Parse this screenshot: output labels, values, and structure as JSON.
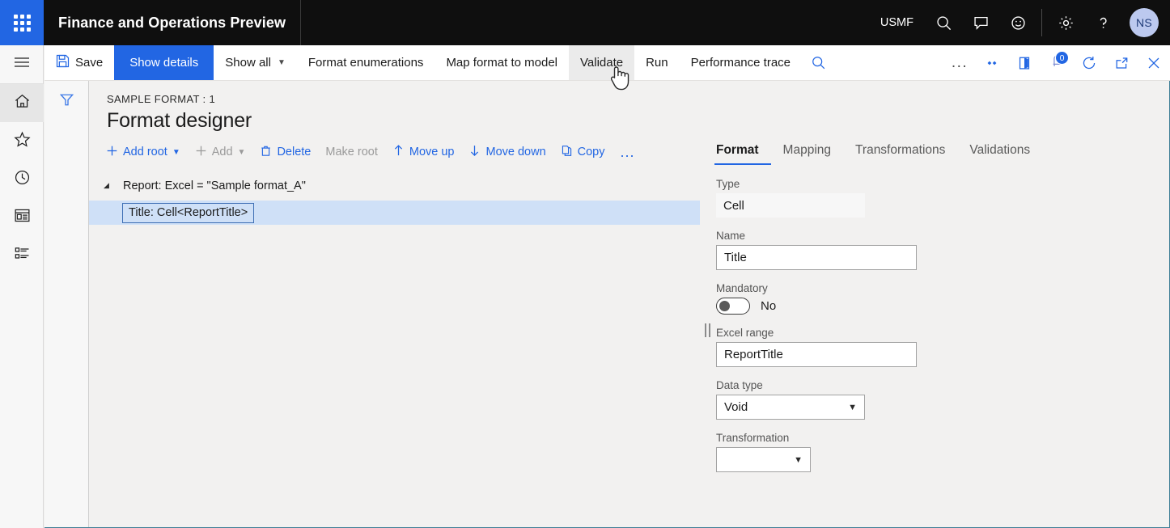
{
  "topbar": {
    "waffle_name": "app-launcher",
    "brand": "Finance and Operations Preview",
    "company": "USMF",
    "icons": [
      "search-icon",
      "feedback-icon",
      "smiley-icon",
      "settings-icon",
      "help-icon"
    ],
    "avatar_initials": "NS",
    "background": "#0f0f0f",
    "accent": "#2266e3"
  },
  "rail": {
    "items": [
      {
        "name": "hamburger-menu",
        "label": "Expand navigation"
      },
      {
        "name": "home",
        "label": "Home",
        "active": true
      },
      {
        "name": "favorites",
        "label": "Favorites"
      },
      {
        "name": "recent",
        "label": "Recent"
      },
      {
        "name": "workspaces",
        "label": "Workspaces"
      },
      {
        "name": "modules",
        "label": "Modules"
      }
    ]
  },
  "commandbar": {
    "save_label": "Save",
    "show_details_label": "Show details",
    "show_all_label": "Show all",
    "format_enumerations_label": "Format enumerations",
    "map_format_to_model_label": "Map format to model",
    "validate_label": "Validate",
    "run_label": "Run",
    "performance_trace_label": "Performance trace",
    "overflow_label": "...",
    "notification_count": "0",
    "primary_color": "#2266e3"
  },
  "page": {
    "eyebrow": "SAMPLE FORMAT : 1",
    "title": "Format designer"
  },
  "tree_toolbar": {
    "add_root_label": "Add root",
    "add_label": "Add",
    "delete_label": "Delete",
    "make_root_label": "Make root",
    "move_up_label": "Move up",
    "move_down_label": "Move down",
    "copy_label": "Copy",
    "more_label": "..."
  },
  "tree": {
    "root": {
      "label": "Report: Excel = \"Sample format_A\"",
      "expanded": true
    },
    "child": {
      "label": "Title: Cell<ReportTitle>",
      "selected": true,
      "highlight": "#cfe0f7"
    }
  },
  "details": {
    "tabs": [
      {
        "label": "Format",
        "active": true
      },
      {
        "label": "Mapping",
        "active": false
      },
      {
        "label": "Transformations",
        "active": false
      },
      {
        "label": "Validations",
        "active": false
      }
    ],
    "fields": {
      "type": {
        "label": "Type",
        "value": "Cell",
        "readonly": true
      },
      "name": {
        "label": "Name",
        "value": "Title"
      },
      "mandatory": {
        "label": "Mandatory",
        "value": "No",
        "on": false
      },
      "excel_range": {
        "label": "Excel range",
        "value": "ReportTitle"
      },
      "data_type": {
        "label": "Data type",
        "value": "Void"
      },
      "transformation": {
        "label": "Transformation",
        "value": ""
      }
    }
  }
}
